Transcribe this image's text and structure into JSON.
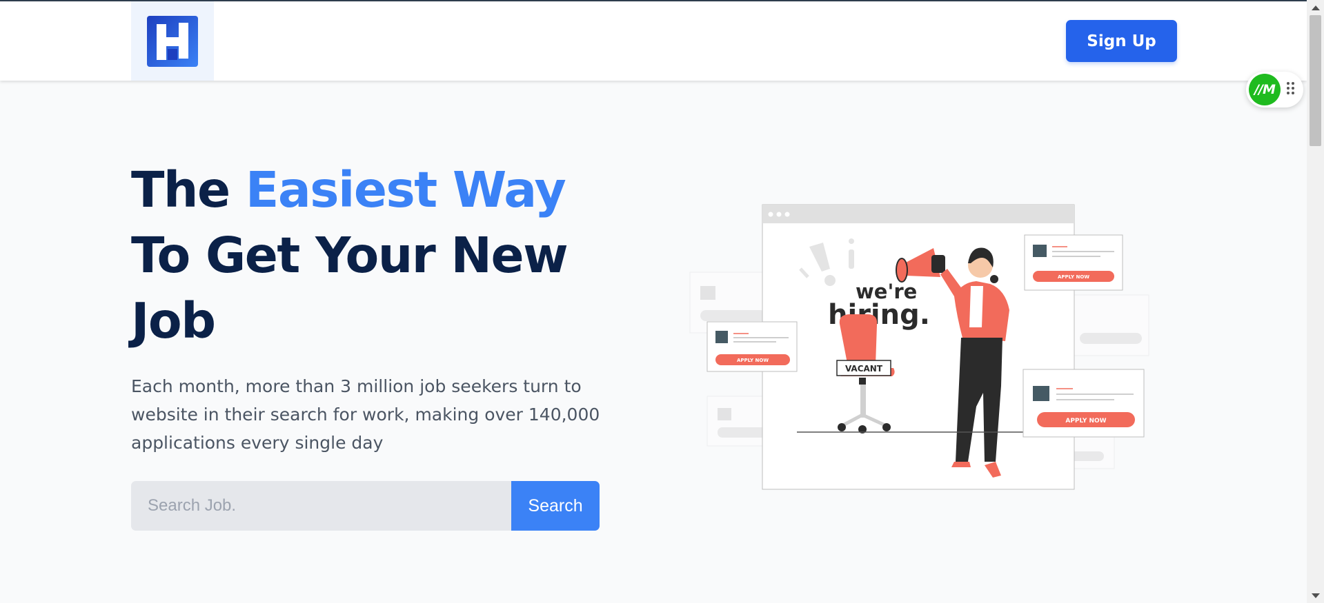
{
  "header": {
    "logo_icon": "h-logo-icon",
    "signup_label": "Sign Up"
  },
  "extension": {
    "logo_text": "//M",
    "drag_icon": "drag-handle-icon"
  },
  "hero": {
    "title_part1": "The ",
    "title_accent": "Easiest Way",
    "title_part2": "To Get Your New Job",
    "description": "Each month, more than 3 million job seekers turn to website in their search for work, making over 140,000 applications every single day"
  },
  "search": {
    "placeholder": "Search Job.",
    "button_label": "Search"
  },
  "illustration": {
    "headline_line1": "we're",
    "headline_line2": "hiring.",
    "vacant_label": "VACANT",
    "apply_label": "APPLY NOW"
  },
  "colors": {
    "primary": "#2563eb",
    "accent": "#3b82f6",
    "heading": "#0b2148",
    "coral": "#f26b5b"
  }
}
